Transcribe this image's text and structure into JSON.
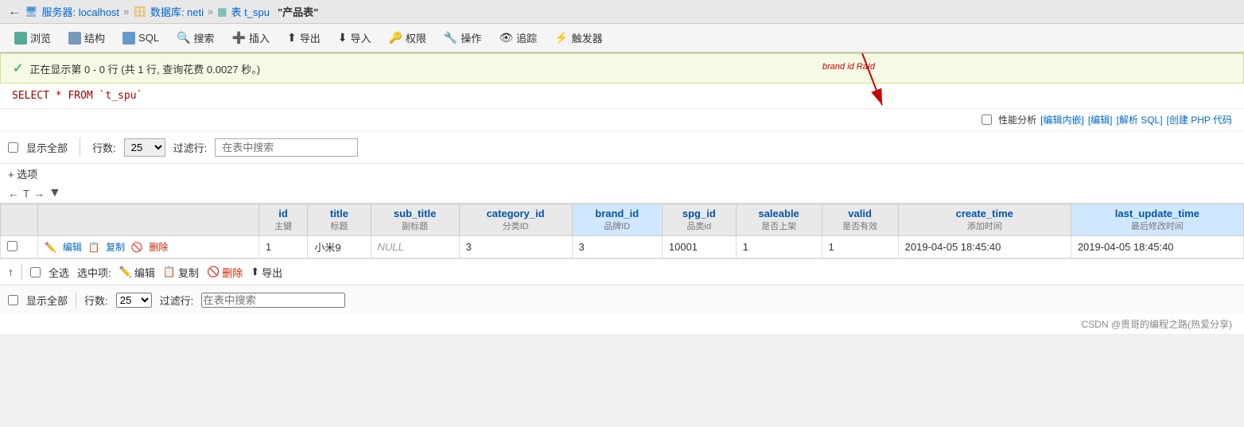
{
  "breadcrumb": {
    "back_label": "←",
    "server_icon": "server-icon",
    "server_label": "服务器: localhost",
    "sep1": "»",
    "db_icon": "db-icon",
    "db_label": "数据库: neti",
    "sep2": "»",
    "table_icon": "table-icon",
    "table_label": "表 t_spu",
    "current_label": "\"产品表\""
  },
  "toolbar": {
    "browse": "浏览",
    "structure": "结构",
    "sql": "SQL",
    "search": "搜索",
    "insert": "插入",
    "export": "导出",
    "import": "导入",
    "priv": "权限",
    "ops": "操作",
    "trace": "追踪",
    "trigger": "触发器"
  },
  "status": {
    "icon": "✓",
    "text": "正在显示第 0 - 0 行 (共 1 行, 查询花费 0.0027 秒。)"
  },
  "sql_query": "SELECT * FROM `t_spu`",
  "performance": {
    "checkbox_label": "性能分析",
    "link1": "[编辑内嵌]",
    "link2": "[编辑]",
    "link3": "[解析 SQL]",
    "link4": "[创建 PHP 代码"
  },
  "table_controls": {
    "show_all_label": "显示全部",
    "rows_label": "行数:",
    "rows_value": "25",
    "filter_label": "过滤行:",
    "filter_placeholder": "在表中搜索"
  },
  "options_label": "+ 选项",
  "columns": [
    {
      "name": "id",
      "sub": "主键"
    },
    {
      "name": "title",
      "sub": "标题"
    },
    {
      "name": "sub_title",
      "sub": "副标题"
    },
    {
      "name": "category_id",
      "sub": "分类ID"
    },
    {
      "name": "brand_id",
      "sub": "品牌ID"
    },
    {
      "name": "spg_id",
      "sub": "品类id"
    },
    {
      "name": "saleable",
      "sub": "是否上架"
    },
    {
      "name": "valid",
      "sub": "是否有效"
    },
    {
      "name": "create_time",
      "sub": "添加时间"
    },
    {
      "name": "last_update_time",
      "sub": "最后修改时间"
    }
  ],
  "row": {
    "id": "1",
    "title": "小米9",
    "sub_title": "NULL",
    "category_id": "3",
    "brand_id": "3",
    "spg_id": "10001",
    "saleable": "1",
    "valid": "1",
    "create_time": "2019-04-05 18:45:40",
    "last_update_time": "2019-04-05 18:45:40"
  },
  "row_actions": {
    "edit": "编辑",
    "copy": "复制",
    "delete": "删除"
  },
  "bottom_actions": {
    "select_all": "全选",
    "selected_label": "选中项:",
    "edit": "编辑",
    "copy": "复制",
    "delete": "删除",
    "export": "导出"
  },
  "footer": {
    "show_all_label": "显示全部",
    "rows_label": "行数:",
    "rows_value": "25",
    "filter_label": "过滤行:",
    "filter_placeholder": "在表中搜索"
  },
  "watermark": "CSDN @贵哥的编程之路(热爱分享)",
  "arrow_annotation": {
    "label": "brand id RaId"
  }
}
